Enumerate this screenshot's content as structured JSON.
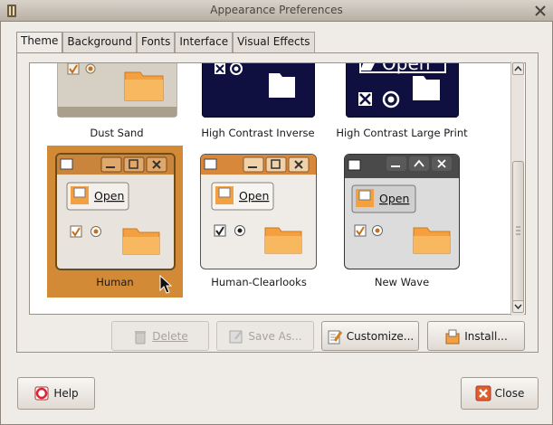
{
  "window": {
    "title": "Appearance Preferences"
  },
  "tabs": [
    {
      "label": "Theme"
    },
    {
      "label": "Background"
    },
    {
      "label": "Fonts"
    },
    {
      "label": "Interface"
    },
    {
      "label": "Visual Effects"
    }
  ],
  "themes": [
    {
      "name": "Dust Sand"
    },
    {
      "name": "High Contrast Inverse"
    },
    {
      "name": "High Contrast Large Print"
    },
    {
      "name": "Human",
      "selected": true
    },
    {
      "name": "Human-Clearlooks"
    },
    {
      "name": "New Wave"
    }
  ],
  "preview": {
    "open_label": "Open"
  },
  "actions": {
    "delete": "Delete",
    "save_as": "Save As...",
    "customize": "Customize...",
    "install": "Install..."
  },
  "footer": {
    "help": "Help",
    "close": "Close"
  },
  "colors": {
    "human_orange": "#d28a37",
    "hc_navy": "#101040",
    "new_wave_gray": "#4a4a4a"
  }
}
